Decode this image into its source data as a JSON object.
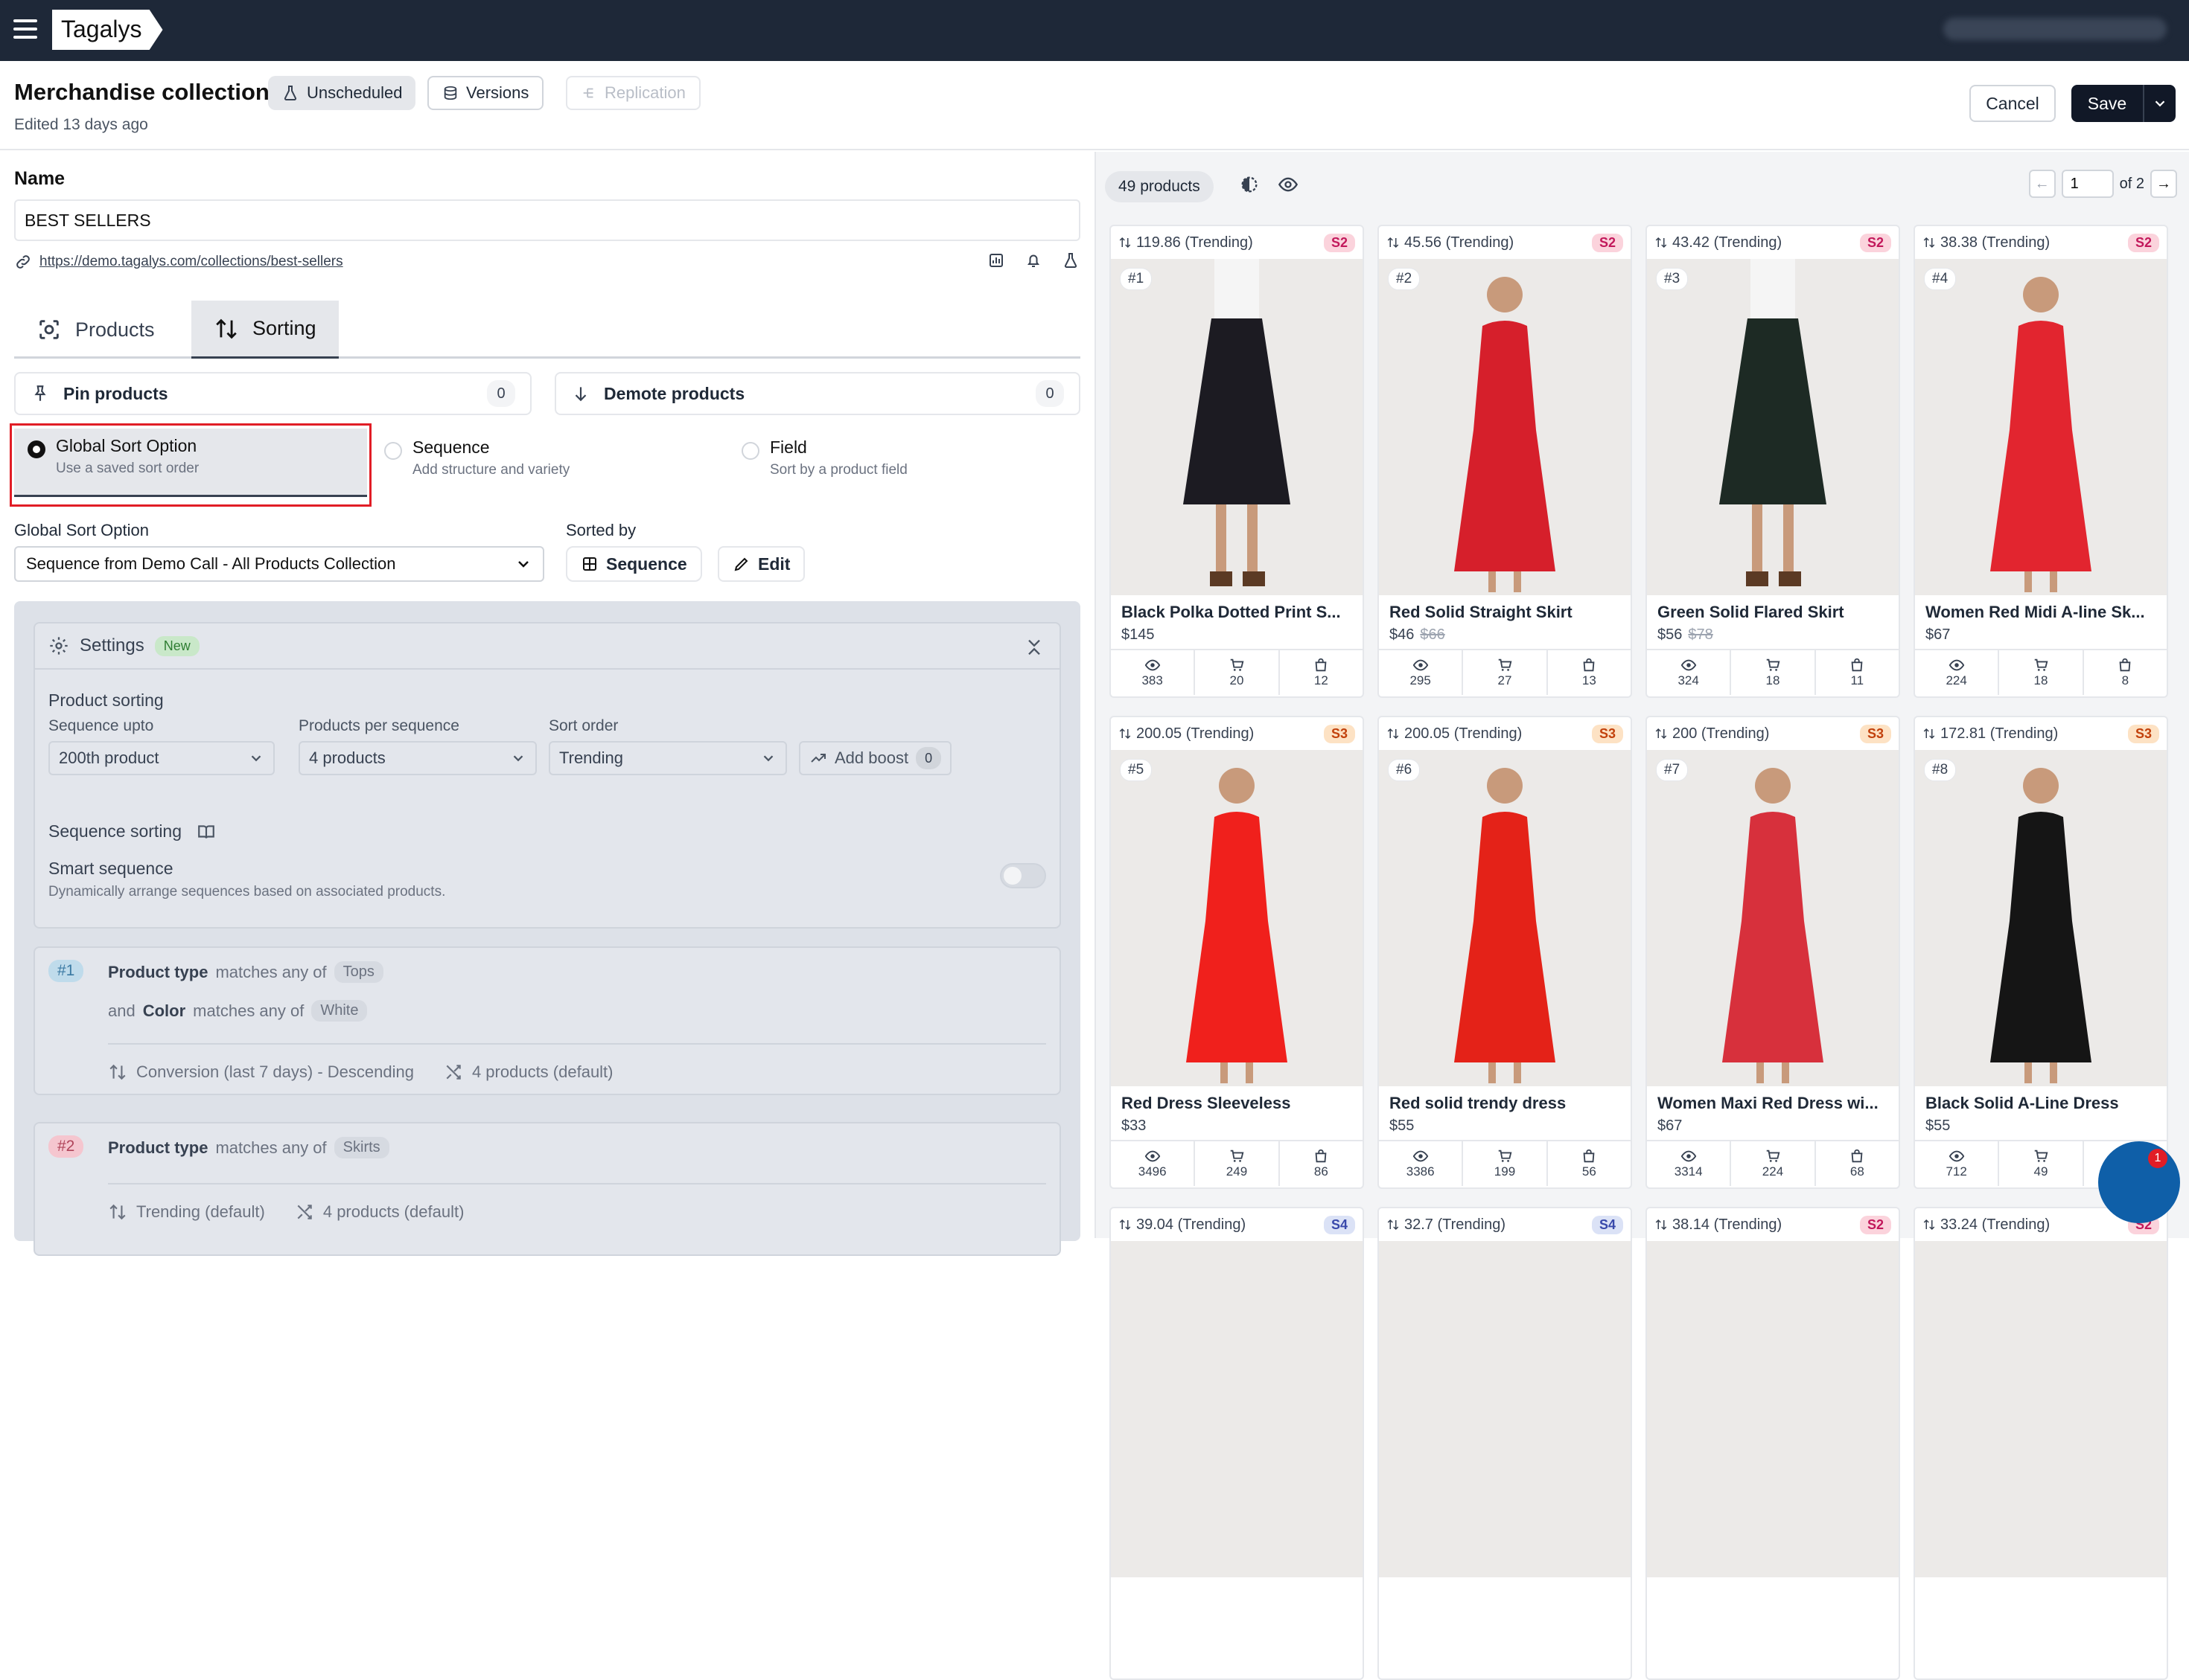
{
  "app": {
    "logo": "Tagalys"
  },
  "header": {
    "title": "Merchandise collection",
    "status_badge": "Unscheduled",
    "versions_label": "Versions",
    "replication_label": "Replication",
    "edited": "Edited 13 days ago",
    "cancel_label": "Cancel",
    "save_label": "Save"
  },
  "form": {
    "name_label": "Name",
    "name_value": "BEST SELLERS",
    "url": "https://demo.tagalys.com/collections/best-sellers"
  },
  "tabs": [
    {
      "label": "Products",
      "active": false
    },
    {
      "label": "Sorting",
      "active": true
    }
  ],
  "pin": {
    "label": "Pin products",
    "count": "0"
  },
  "demote": {
    "label": "Demote products",
    "count": "0"
  },
  "sort_options": [
    {
      "title": "Global Sort Option",
      "desc": "Use a saved sort order",
      "selected": true
    },
    {
      "title": "Sequence",
      "desc": "Add structure and variety",
      "selected": false
    },
    {
      "title": "Field",
      "desc": "Sort by a product field",
      "selected": false
    }
  ],
  "global_sort": {
    "label": "Global Sort Option",
    "value": "Sequence from Demo Call - All Products Collection",
    "sorted_by_label": "Sorted by",
    "sequence_btn": "Sequence",
    "edit_btn": "Edit"
  },
  "settings": {
    "title": "Settings",
    "badge": "New",
    "product_sorting": "Product sorting",
    "seq_upto_label": "Sequence upto",
    "seq_upto_value": "200th product",
    "per_seq_label": "Products per sequence",
    "per_seq_value": "4 products",
    "sort_order_label": "Sort order",
    "sort_order_value": "Trending",
    "add_boost": "Add boost",
    "boost_count": "0",
    "sequence_sorting": "Sequence sorting",
    "smart_title": "Smart sequence",
    "smart_desc": "Dynamically arrange sequences based on associated products.",
    "smart_on": false
  },
  "rules": [
    {
      "num": "#1",
      "line1_field": "Product type",
      "line1_op": "matches any of",
      "line1_value": "Tops",
      "line2_prefix": "and",
      "line2_field": "Color",
      "line2_op": "matches any of",
      "line2_value": "White",
      "sort": "Conversion (last 7 days) - Descending",
      "count": "4 products (default)"
    },
    {
      "num": "#2",
      "line1_field": "Product type",
      "line1_op": "matches any of",
      "line1_value": "Skirts",
      "sort": "Trending (default)",
      "count": "4 products (default)"
    }
  ],
  "results": {
    "count_label": "49 products",
    "page": "1",
    "of_label": "of 2"
  },
  "products": [
    {
      "score": "119.86 (Trending)",
      "seq": "S2",
      "rank": "#1",
      "name": "Black Polka Dotted Print S...",
      "price": "$145",
      "old_price": "",
      "views": "383",
      "carts": "20",
      "buys": "12",
      "color": "#1c1b22",
      "kind": "skirt"
    },
    {
      "score": "45.56 (Trending)",
      "seq": "S2",
      "rank": "#2",
      "name": "Red Solid Straight Skirt",
      "price": "$46",
      "old_price": "$66",
      "views": "295",
      "carts": "27",
      "buys": "13",
      "color": "#d61f2b",
      "kind": "dress"
    },
    {
      "score": "43.42 (Trending)",
      "seq": "S2",
      "rank": "#3",
      "name": "Green Solid Flared Skirt",
      "price": "$56",
      "old_price": "$78",
      "views": "324",
      "carts": "18",
      "buys": "11",
      "color": "#1d2a24",
      "kind": "skirt"
    },
    {
      "score": "38.38 (Trending)",
      "seq": "S2",
      "rank": "#4",
      "name": "Women Red Midi A-line Sk...",
      "price": "$67",
      "old_price": "",
      "views": "224",
      "carts": "18",
      "buys": "8",
      "color": "#e2252f",
      "kind": "dress"
    },
    {
      "score": "200.05 (Trending)",
      "seq": "S3",
      "rank": "#5",
      "name": "Red Dress Sleeveless",
      "price": "$33",
      "old_price": "",
      "views": "3496",
      "carts": "249",
      "buys": "86",
      "color": "#f0201c",
      "kind": "dress"
    },
    {
      "score": "200.05 (Trending)",
      "seq": "S3",
      "rank": "#6",
      "name": "Red solid trendy dress",
      "price": "$55",
      "old_price": "",
      "views": "3386",
      "carts": "199",
      "buys": "56",
      "color": "#e42218",
      "kind": "dress"
    },
    {
      "score": "200 (Trending)",
      "seq": "S3",
      "rank": "#7",
      "name": "Women Maxi Red Dress wi...",
      "price": "$67",
      "old_price": "",
      "views": "3314",
      "carts": "224",
      "buys": "68",
      "color": "#d7303c",
      "kind": "dress"
    },
    {
      "score": "172.81 (Trending)",
      "seq": "S3",
      "rank": "#8",
      "name": "Black Solid A-Line Dress",
      "price": "$55",
      "old_price": "",
      "views": "712",
      "carts": "49",
      "buys": "",
      "color": "#151515",
      "kind": "dress"
    },
    {
      "score": "39.04 (Trending)",
      "seq": "S4",
      "rank": "",
      "name": "",
      "price": "",
      "old_price": "",
      "views": "",
      "carts": "",
      "buys": "",
      "color": "#eceae8",
      "kind": "none"
    },
    {
      "score": "32.7 (Trending)",
      "seq": "S4",
      "rank": "",
      "name": "",
      "price": "",
      "old_price": "",
      "views": "",
      "carts": "",
      "buys": "",
      "color": "#eceae8",
      "kind": "none"
    },
    {
      "score": "38.14 (Trending)",
      "seq": "S2",
      "rank": "",
      "name": "",
      "price": "",
      "old_price": "",
      "views": "",
      "carts": "",
      "buys": "",
      "color": "#eceae8",
      "kind": "none"
    },
    {
      "score": "33.24 (Trending)",
      "seq": "S2",
      "rank": "",
      "name": "",
      "price": "",
      "old_price": "",
      "views": "",
      "carts": "",
      "buys": "",
      "color": "#eceae8",
      "kind": "none"
    }
  ],
  "chat": {
    "badge": "1"
  }
}
